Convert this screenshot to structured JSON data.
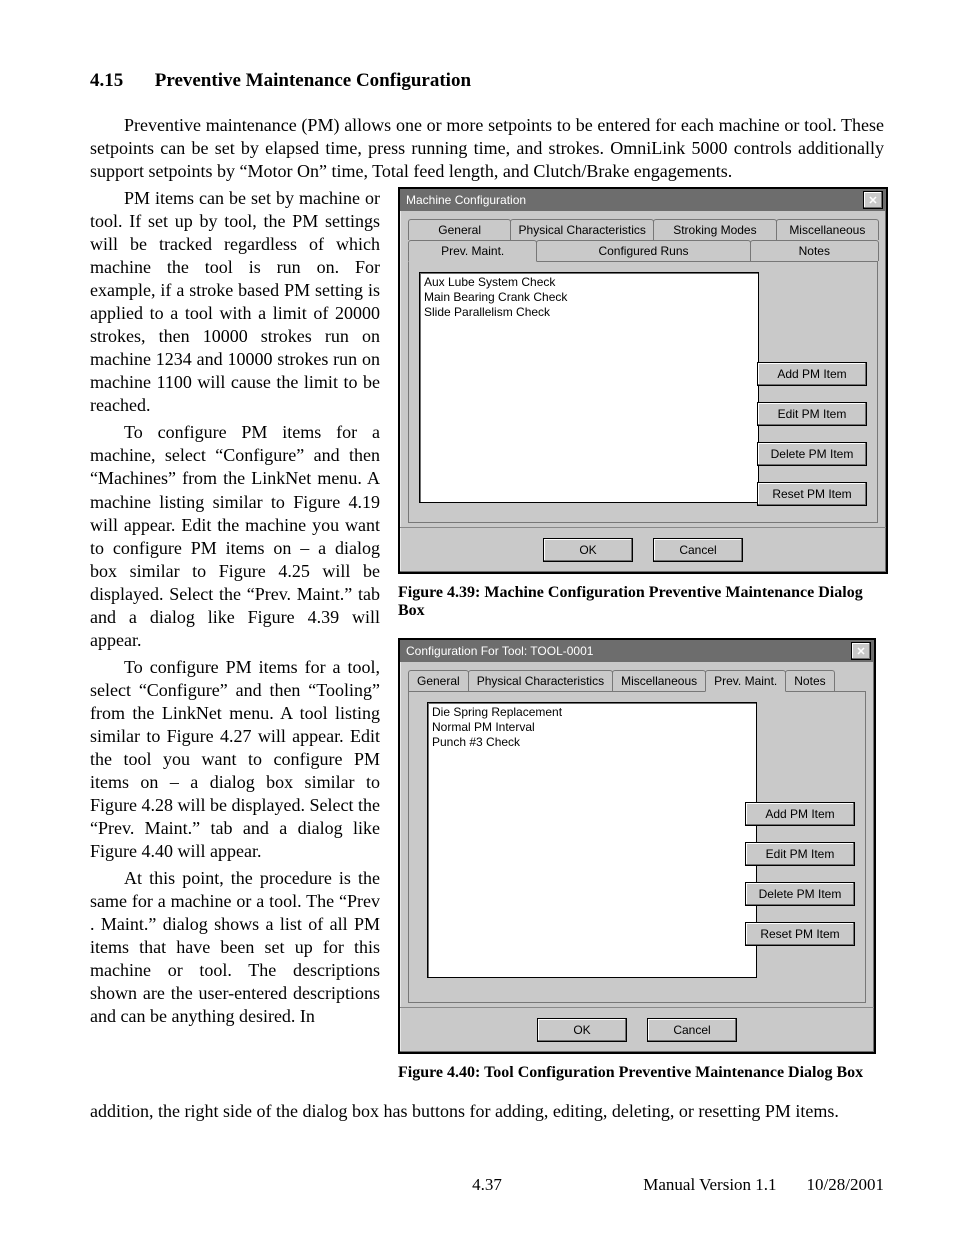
{
  "section": {
    "number": "4.15",
    "title": "Preventive Maintenance Configuration"
  },
  "intro": "Preventive maintenance (PM) allows one or more setpoints to be entered for each machine or tool. These setpoints can be set by elapsed time, press running time, and strokes.  OmniLink 5000 controls additionally support setpoints by “Motor On” time, Total feed length, and Clutch/Brake engagements.",
  "para1": "PM items can be set by machine or tool.  If set up by tool, the PM settings will be tracked regardless of which machine the tool is run on.  For example, if a stroke based PM setting is applied to a tool with a limit of 20000 strokes, then 10000 strokes run on machine 1234 and 10000 strokes run on machine 1100 will cause the limit to be reached.",
  "para2": "To configure PM items for a machine, select “Configure” and then “Machines” from the LinkNet menu.  A machine listing similar to Figure 4.19 will appear.  Edit the machine you want to configure PM items on – a dialog box similar to Figure 4.25 will be displayed.  Select the “Prev. Maint.” tab and a dialog like Figure 4.39 will appear.",
  "para3": "To configure PM items for a tool, select “Configure” and then “Tooling” from the LinkNet menu.  A tool listing similar to Figure 4.27 will appear.  Edit the tool you want to configure PM items on – a dialog box similar to Figure 4.28 will be displayed.  Select the “Prev. Maint.” tab and a dialog like Figure 4.40 will appear.",
  "para4": "At this point, the procedure is the same for a machine or a tool.  The “Prev . Maint.” dialog shows a list of all PM items that have been set up for this machine or tool.  The descriptions shown are the user-entered descriptions and can be anything desired.  In",
  "tail": "addition, the right side of the dialog box has buttons for adding, editing, deleting, or resetting PM items.",
  "dialog1": {
    "title": "Machine Configuration",
    "tabs_row1": [
      "General",
      "Physical Characteristics",
      "Stroking Modes",
      "Miscellaneous"
    ],
    "tabs_row2": [
      "Prev. Maint.",
      "Configured Runs",
      "Notes"
    ],
    "active_tab": "Prev. Maint.",
    "list": [
      "Aux Lube System Check",
      "Main Bearing Crank Check",
      "Slide Parallelism Check"
    ],
    "buttons": [
      "Add PM Item",
      "Edit PM Item",
      "Delete PM Item",
      "Reset PM Item"
    ],
    "ok": "OK",
    "cancel": "Cancel",
    "caption": "Figure 4.39: Machine Configuration Preventive Maintenance Dialog Box"
  },
  "dialog2": {
    "title": "Configuration For Tool: TOOL-0001",
    "tabs": [
      "General",
      "Physical Characteristics",
      "Miscellaneous",
      "Prev. Maint.",
      "Notes"
    ],
    "active_tab": "Prev. Maint.",
    "list": [
      "Die Spring Replacement",
      "Normal PM Interval",
      "Punch #3 Check"
    ],
    "buttons": [
      "Add PM Item",
      "Edit PM Item",
      "Delete PM Item",
      "Reset PM Item"
    ],
    "ok": "OK",
    "cancel": "Cancel",
    "caption": "Figure 4.40: Tool Configuration Preventive Maintenance Dialog Box"
  },
  "footer": {
    "page": "4.37",
    "version": "Manual Version 1.1",
    "date": "10/28/2001"
  }
}
